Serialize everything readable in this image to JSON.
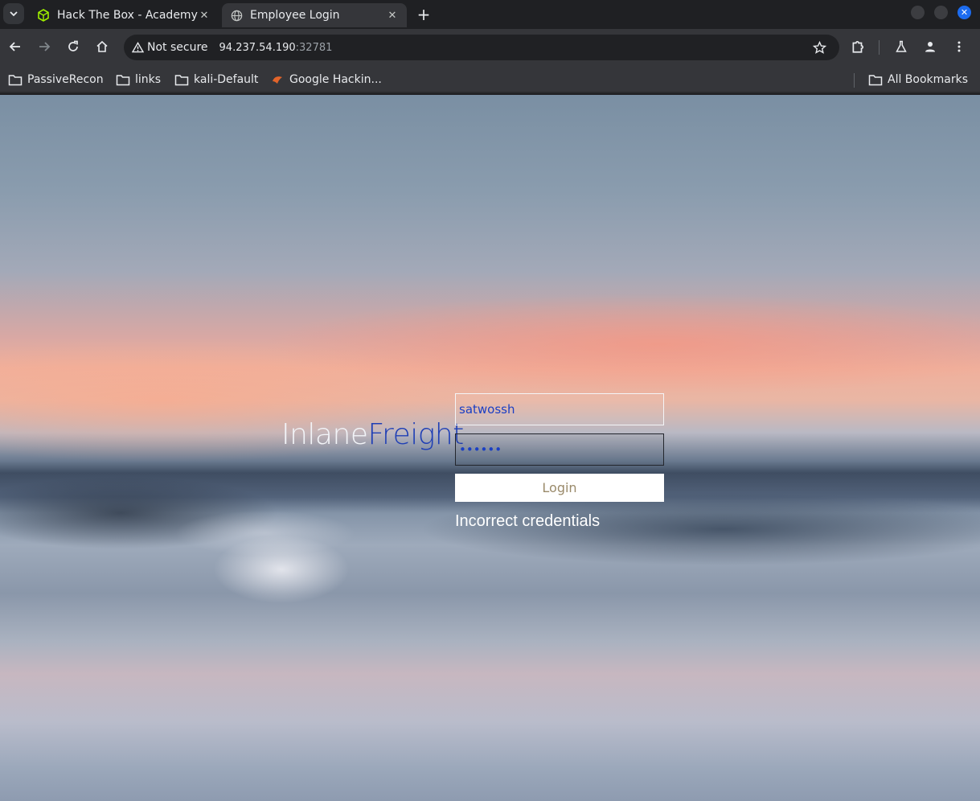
{
  "browser": {
    "tabs": [
      {
        "title": "Hack The Box - Academy",
        "favicon": "htb-cube-icon",
        "active": false
      },
      {
        "title": "Employee Login",
        "favicon": "globe-icon",
        "active": true
      }
    ],
    "address": {
      "security_label": "Not secure",
      "host": "94.237.54.190",
      "port": ":32781"
    },
    "bookmarks": [
      {
        "label": "PassiveRecon",
        "icon": "folder-icon"
      },
      {
        "label": "links",
        "icon": "folder-icon"
      },
      {
        "label": "kali-Default",
        "icon": "folder-icon"
      },
      {
        "label": "Google Hackin...",
        "icon": "google-hacking-icon"
      }
    ],
    "all_bookmarks_label": "All Bookmarks",
    "colors": {
      "window_close": "#1c6cf0",
      "tab_active": "#35363a",
      "favicon_htb": "#9fef00"
    }
  },
  "login": {
    "brand_part1": "Inlane",
    "brand_part2": "Freight",
    "username_value": "satwossh",
    "password_value": "••••••",
    "login_button": "Login",
    "error_message": "Incorrect credentials",
    "colors": {
      "brand_accent": "#1f3fb5",
      "input_text": "#1a3fc4"
    }
  }
}
